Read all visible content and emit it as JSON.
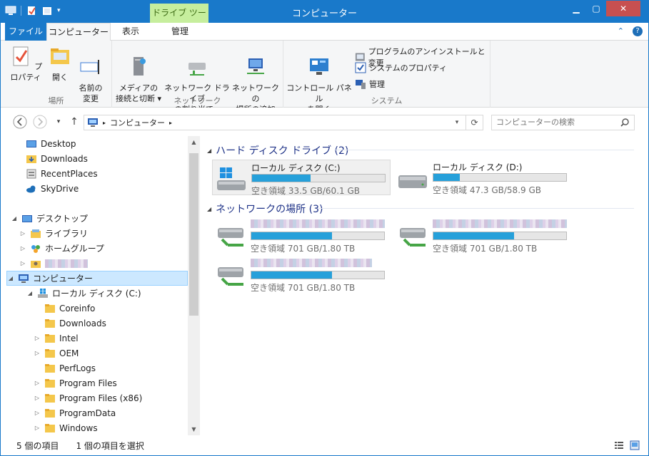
{
  "window": {
    "title": "コンピューター",
    "context_tab": "ドライブ ツール"
  },
  "ribbon_tabs": {
    "file": "ファイル",
    "computer": "コンピューター",
    "view": "表示",
    "manage": "管理"
  },
  "ribbon": {
    "location_group": "場所",
    "network_group": "ネットワーク",
    "system_group": "システム",
    "properties": "プロパティ",
    "open": "開く",
    "rename": "名前の\n変更",
    "media_access": "メディアの\n接続と切断 ▾",
    "map_drive": "ネットワーク ドライブ\nの割り当て ▾",
    "add_network_location": "ネットワークの\n場所の追加",
    "control_panel": "コントロール パネル\nを開く",
    "uninstall": "プログラムのアンインストールと変更",
    "system_properties": "システムのプロパティ",
    "manage": "管理"
  },
  "address": {
    "path": "コンピューター",
    "search_placeholder": "コンピューターの検索"
  },
  "nav": {
    "favorites": [
      {
        "label": "Desktop"
      },
      {
        "label": "Downloads"
      },
      {
        "label": "RecentPlaces"
      },
      {
        "label": "SkyDrive"
      }
    ],
    "desktop": "デスクトップ",
    "libraries": "ライブラリ",
    "homegroup": "ホームグループ",
    "computer": "コンピューター",
    "local_disk": "ローカル ディスク (C:)",
    "folders": [
      {
        "label": "Coreinfo"
      },
      {
        "label": "Downloads"
      },
      {
        "label": "Intel"
      },
      {
        "label": "OEM"
      },
      {
        "label": "PerfLogs"
      },
      {
        "label": "Program Files"
      },
      {
        "label": "Program Files (x86)"
      },
      {
        "label": "ProgramData"
      },
      {
        "label": "Windows"
      }
    ]
  },
  "content": {
    "hdd_group": "ハード ディスク ドライブ (2)",
    "net_group": "ネットワークの場所 (3)",
    "drives": [
      {
        "name": "ローカル ディスク (C:)",
        "free": "空き領域 33.5 GB/60.1 GB",
        "used_fraction": 0.44
      },
      {
        "name": "ローカル ディスク (D:)",
        "free": "空き領域 47.3 GB/58.9 GB",
        "used_fraction": 0.2
      }
    ],
    "network": [
      {
        "free": "空き領域 701 GB/1.80 TB",
        "used_fraction": 0.61
      },
      {
        "free": "空き領域 701 GB/1.80 TB",
        "used_fraction": 0.61
      },
      {
        "free": "空き領域 701 GB/1.80 TB",
        "used_fraction": 0.61
      }
    ]
  },
  "status": {
    "items": "5 個の項目",
    "selected": "1 個の項目を選択"
  },
  "colors": {
    "accent": "#1979ca",
    "context_tab": "#c6ee9d",
    "bar_fill": "#26a0da",
    "selection": "#cce8ff"
  }
}
